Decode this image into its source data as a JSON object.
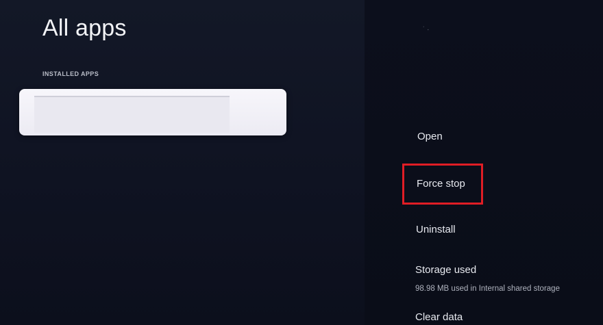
{
  "left": {
    "title": "All apps",
    "section_label": "INSTALLED APPS"
  },
  "right": {
    "header_fragment": "˙ ·",
    "actions": {
      "open": "Open",
      "force_stop": "Force stop",
      "uninstall": "Uninstall",
      "storage_used": "Storage used",
      "storage_detail": "98.98 MB used in Internal shared storage",
      "clear_data": "Clear data"
    }
  },
  "colors": {
    "highlight": "#e01d25",
    "background": "#0b0e1a",
    "card": "#f4f3f8"
  }
}
